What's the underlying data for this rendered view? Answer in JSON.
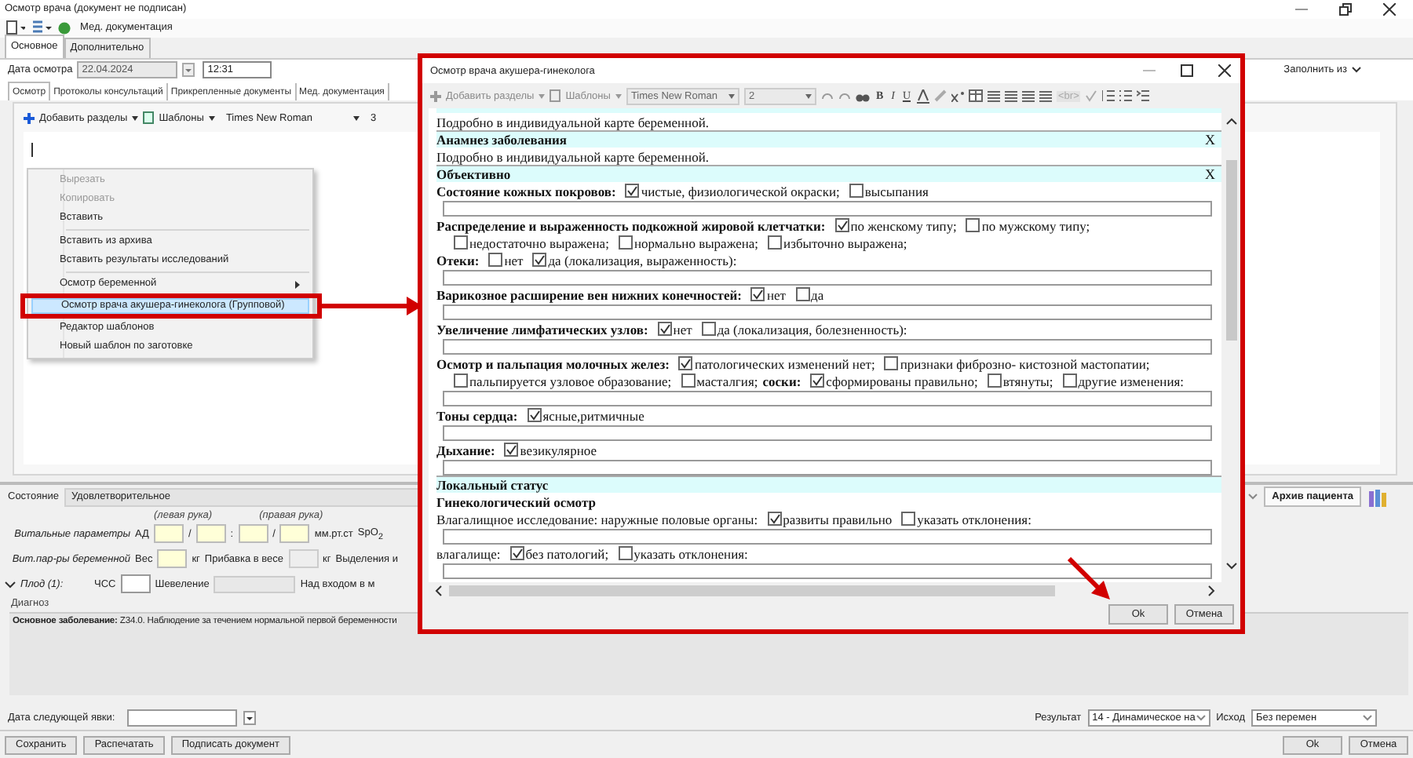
{
  "window": {
    "title": "Осмотр врача (документ не подписан)"
  },
  "toolbar": {
    "label": "Мед. документация"
  },
  "tabs": [
    {
      "label": "Основное",
      "selected": true
    },
    {
      "label": "Дополнительно",
      "selected": false
    }
  ],
  "exam_date": {
    "label": "Дата осмотра",
    "date": "22.04.2024",
    "time": "12:31"
  },
  "fill_from": "Заполнить из",
  "doc_tabs": [
    {
      "label": "Осмотр",
      "selected": true
    },
    {
      "label": "Протоколы консультаций",
      "selected": false
    },
    {
      "label": "Прикрепленные документы",
      "selected": false
    },
    {
      "label": "Мед. документация",
      "selected": false
    }
  ],
  "editor_toolbar": {
    "add": "Добавить разделы",
    "templates": "Шаблоны",
    "font": "Times New Roman",
    "size": "3"
  },
  "context_menu": [
    {
      "kind": "item",
      "label": "Вырезать",
      "disabled": true,
      "selected": false,
      "submenu": false
    },
    {
      "kind": "item",
      "label": "Копировать",
      "disabled": true,
      "selected": false,
      "submenu": false
    },
    {
      "kind": "item",
      "label": "Вставить",
      "disabled": false,
      "selected": false,
      "submenu": false
    },
    {
      "kind": "separator"
    },
    {
      "kind": "item",
      "label": "Вставить из архива",
      "disabled": false,
      "selected": false,
      "submenu": false
    },
    {
      "kind": "item",
      "label": "Вставить результаты исследований",
      "disabled": false,
      "selected": false,
      "submenu": false
    },
    {
      "kind": "separator"
    },
    {
      "kind": "item",
      "label": "Осмотр беременной",
      "disabled": false,
      "selected": false,
      "submenu": true
    },
    {
      "kind": "item",
      "label": "Осмотр врача акушера-гинеколога (Групповой)",
      "disabled": false,
      "selected": true,
      "submenu": false
    },
    {
      "kind": "item",
      "label": "Редактор шаблонов",
      "disabled": false,
      "selected": false,
      "submenu": false
    },
    {
      "kind": "item",
      "label": "Новый шаблон по заготовке",
      "disabled": false,
      "selected": false,
      "submenu": false
    }
  ],
  "dialog": {
    "title": "Осмотр врача акушера-гинеколога",
    "toolbar": {
      "add": "Добавить разделы",
      "templates": "Шаблоны",
      "font": "Times New Roman",
      "size": "2",
      "format": [
        "B",
        "I",
        "U"
      ],
      "br": "<br>"
    },
    "lines": [
      {
        "kind": "text",
        "text": "Подробно в индивидуальной карте беременной."
      },
      {
        "kind": "header",
        "title": "Анамнез заболевания",
        "close": "X"
      },
      {
        "kind": "text",
        "text": "Подробно в индивидуальной карте беременной."
      },
      {
        "kind": "header",
        "title": "Объективно",
        "close": "X"
      },
      {
        "kind": "row",
        "parts": [
          {
            "kind": "bold",
            "text": "Состояние кожных покровов:"
          },
          {
            "kind": "check",
            "label": "чистые, физиологической окраски;",
            "checked": true
          },
          {
            "kind": "check",
            "label": "высыпания",
            "checked": false
          }
        ]
      },
      {
        "kind": "input"
      },
      {
        "kind": "row",
        "parts": [
          {
            "kind": "bold",
            "text": "Распределение и выраженность подкожной жировой клетчатки:"
          },
          {
            "kind": "check",
            "label": "по женскому типу;",
            "checked": true
          },
          {
            "kind": "check",
            "label": "по мужскому типу;",
            "checked": false
          }
        ]
      },
      {
        "kind": "continuation",
        "parts": [
          {
            "kind": "check",
            "label": "недостаточно выражена;",
            "checked": false
          },
          {
            "kind": "check",
            "label": "нормально выражена;",
            "checked": false
          },
          {
            "kind": "check",
            "label": "избыточно выражена;",
            "checked": false
          }
        ]
      },
      {
        "kind": "row",
        "parts": [
          {
            "kind": "bold",
            "text": "Отеки:"
          },
          {
            "kind": "check",
            "label": "нет",
            "checked": false
          },
          {
            "kind": "check",
            "label": "да (локализация, выраженность):",
            "checked": true
          }
        ]
      },
      {
        "kind": "input"
      },
      {
        "kind": "row",
        "parts": [
          {
            "kind": "bold",
            "text": "Варикозное расширение вен нижних конечностей:"
          },
          {
            "kind": "check",
            "label": "нет",
            "checked": true
          },
          {
            "kind": "check",
            "label": "да",
            "checked": false
          }
        ]
      },
      {
        "kind": "input"
      },
      {
        "kind": "row",
        "parts": [
          {
            "kind": "bold",
            "text": "Увеличение лимфатических узлов:"
          },
          {
            "kind": "check",
            "label": "нет",
            "checked": true
          },
          {
            "kind": "check",
            "label": "да (локализация, болезненность):",
            "checked": false
          }
        ]
      },
      {
        "kind": "input"
      },
      {
        "kind": "row",
        "parts": [
          {
            "kind": "bold",
            "text": "Осмотр и пальпация молочных желез:"
          },
          {
            "kind": "check",
            "label": "патологических изменений нет;",
            "checked": true
          },
          {
            "kind": "check",
            "label": "признаки фиброзно- кистозной мастопатии;",
            "checked": false
          }
        ]
      },
      {
        "kind": "continuation",
        "parts": [
          {
            "kind": "check",
            "label": "пальпируется узловое образование;",
            "checked": false
          },
          {
            "kind": "check",
            "label": "масталгия;",
            "checked": false
          },
          {
            "kind": "bold",
            "text": "соски:"
          },
          {
            "kind": "check",
            "label": "сформированы правильно;",
            "checked": true
          },
          {
            "kind": "check",
            "label": "втянуты;",
            "checked": false
          },
          {
            "kind": "check",
            "label": "другие изменения:",
            "checked": false
          }
        ]
      },
      {
        "kind": "input"
      },
      {
        "kind": "row",
        "parts": [
          {
            "kind": "bold",
            "text": "Тоны сердца:"
          },
          {
            "kind": "check",
            "label": "ясные,ритмичные",
            "checked": true
          }
        ]
      },
      {
        "kind": "input"
      },
      {
        "kind": "row",
        "parts": [
          {
            "kind": "bold",
            "text": "Дыхание:"
          },
          {
            "kind": "check",
            "label": "везикулярное",
            "checked": true
          }
        ]
      },
      {
        "kind": "input"
      },
      {
        "kind": "header",
        "title": "Локальный статус"
      },
      {
        "kind": "row",
        "parts": [
          {
            "kind": "bold",
            "text": "Гинекологический осмотр"
          }
        ]
      },
      {
        "kind": "row",
        "parts": [
          {
            "kind": "text",
            "text": "Влагалищное исследование: наружные половые органы:"
          },
          {
            "kind": "check",
            "label": "развиты правильно",
            "checked": true
          },
          {
            "kind": "check",
            "label": "указать отклонения:",
            "checked": false
          }
        ]
      },
      {
        "kind": "input"
      },
      {
        "kind": "row",
        "parts": [
          {
            "kind": "text",
            "text": "влагалище:"
          },
          {
            "kind": "check",
            "label": "без патологий;",
            "checked": true
          },
          {
            "kind": "check",
            "label": "указать отклонения:",
            "checked": false
          }
        ]
      },
      {
        "kind": "input"
      }
    ],
    "buttons": [
      "Ok",
      "Отмена"
    ]
  },
  "condition": {
    "label": "Состояние",
    "value": "Удовлетворительное"
  },
  "archive_button": "Архив пациента",
  "vitals": {
    "left_arm": "(левая рука)",
    "right_arm": "(правая рука)",
    "label": "Витальные параметры",
    "bp": "АД",
    "sep1": "/",
    "sep2": ":",
    "sep3": "/",
    "unit": "мм.рт.ст",
    "spo2": "SpO$_{2}$"
  },
  "pregnancy": {
    "label": "Вит.пар-ры беременной",
    "weight": "Вес",
    "kg1": "кг",
    "gain": "Прибавка в весе",
    "kg2": "кг",
    "discharge": "Выделения и"
  },
  "fetus": {
    "label": "Плод (1):",
    "expanded": true,
    "hr": "ЧСС",
    "movement": "Шевеление",
    "above": "Над входом в м"
  },
  "diagnosis": {
    "title": "Диагноз",
    "text": "**Основное заболевание:** Z34.0. Наблюдение за течением нормальной первой беременности"
  },
  "next_visit": {
    "label": "Дата следующей явки:"
  },
  "result": {
    "label": "Результат",
    "value": "14 - Динамическое на"
  },
  "outcome": {
    "label": "Исход",
    "value": "Без перемен"
  },
  "buttons": [
    "Сохранить",
    "Распечатать",
    "Подписать документ"
  ],
  "footer_buttons": [
    "Ok",
    "Отмена"
  ]
}
